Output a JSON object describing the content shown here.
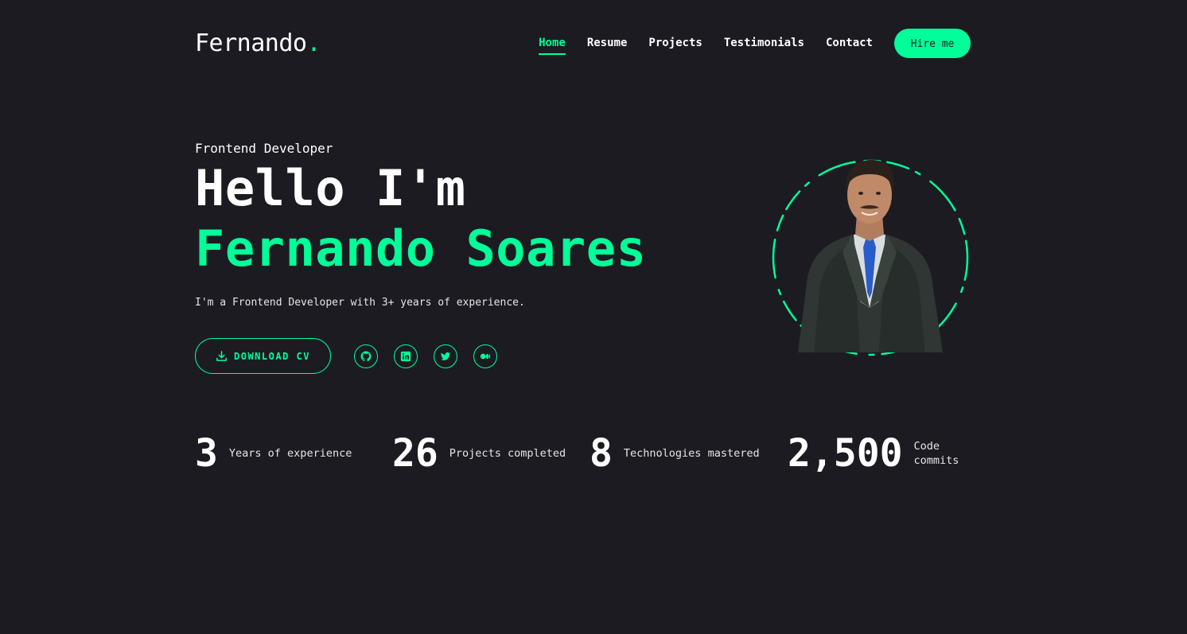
{
  "header": {
    "logo": "Fernando",
    "logo_dot": ".",
    "nav": [
      {
        "label": "Home",
        "active": true
      },
      {
        "label": "Resume",
        "active": false
      },
      {
        "label": "Projects",
        "active": false
      },
      {
        "label": "Testimonials",
        "active": false
      },
      {
        "label": "Contact",
        "active": false
      }
    ],
    "hire_label": "Hire me"
  },
  "hero": {
    "role": "Frontend Developer",
    "greeting": "Hello I'm",
    "name": "Fernando Soares",
    "intro": "I'm a Frontend Developer with 3+ years of experience.",
    "download_label": "DOWNLOAD CV",
    "socials": [
      {
        "icon": "github-icon"
      },
      {
        "icon": "linkedin-icon"
      },
      {
        "icon": "twitter-icon"
      },
      {
        "icon": "medium-icon"
      }
    ]
  },
  "stats": [
    {
      "value": "3",
      "label": "Years of experience"
    },
    {
      "value": "26",
      "label": "Projects completed"
    },
    {
      "value": "8",
      "label": "Technologies mastered"
    },
    {
      "value": "2,500",
      "label": "Code commits"
    }
  ],
  "colors": {
    "background": "#1c1b22",
    "accent": "#00ff99",
    "text": "#ffffff"
  }
}
